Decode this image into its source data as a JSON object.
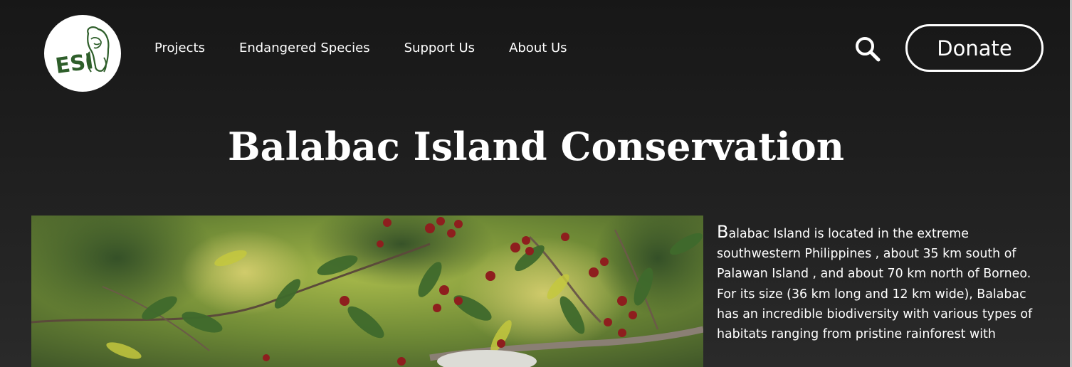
{
  "header": {
    "logo_text": "ESI",
    "nav": [
      {
        "label": "Projects"
      },
      {
        "label": "Endangered Species"
      },
      {
        "label": "Support Us"
      },
      {
        "label": "About Us"
      }
    ],
    "search_icon": "search-icon",
    "donate_label": "Donate"
  },
  "page": {
    "title": "Balabac Island Conservation",
    "photo_subject": "mouse-deer-among-berry-branches",
    "intro_dropcap": "B",
    "intro_rest": "alabac Island is located in the extreme southwestern Philippines , about 35 km south of Palawan Island , and about 70 km north of Borneo.",
    "paragraph_2": "For its size (36 km long and 12 km wide), Balabac has an incredible biodiversity with various types of habitats ranging from pristine rainforest with"
  },
  "colors": {
    "background": "#1d1d1d",
    "logo_green": "#2e5e2a",
    "text": "#ffffff"
  }
}
